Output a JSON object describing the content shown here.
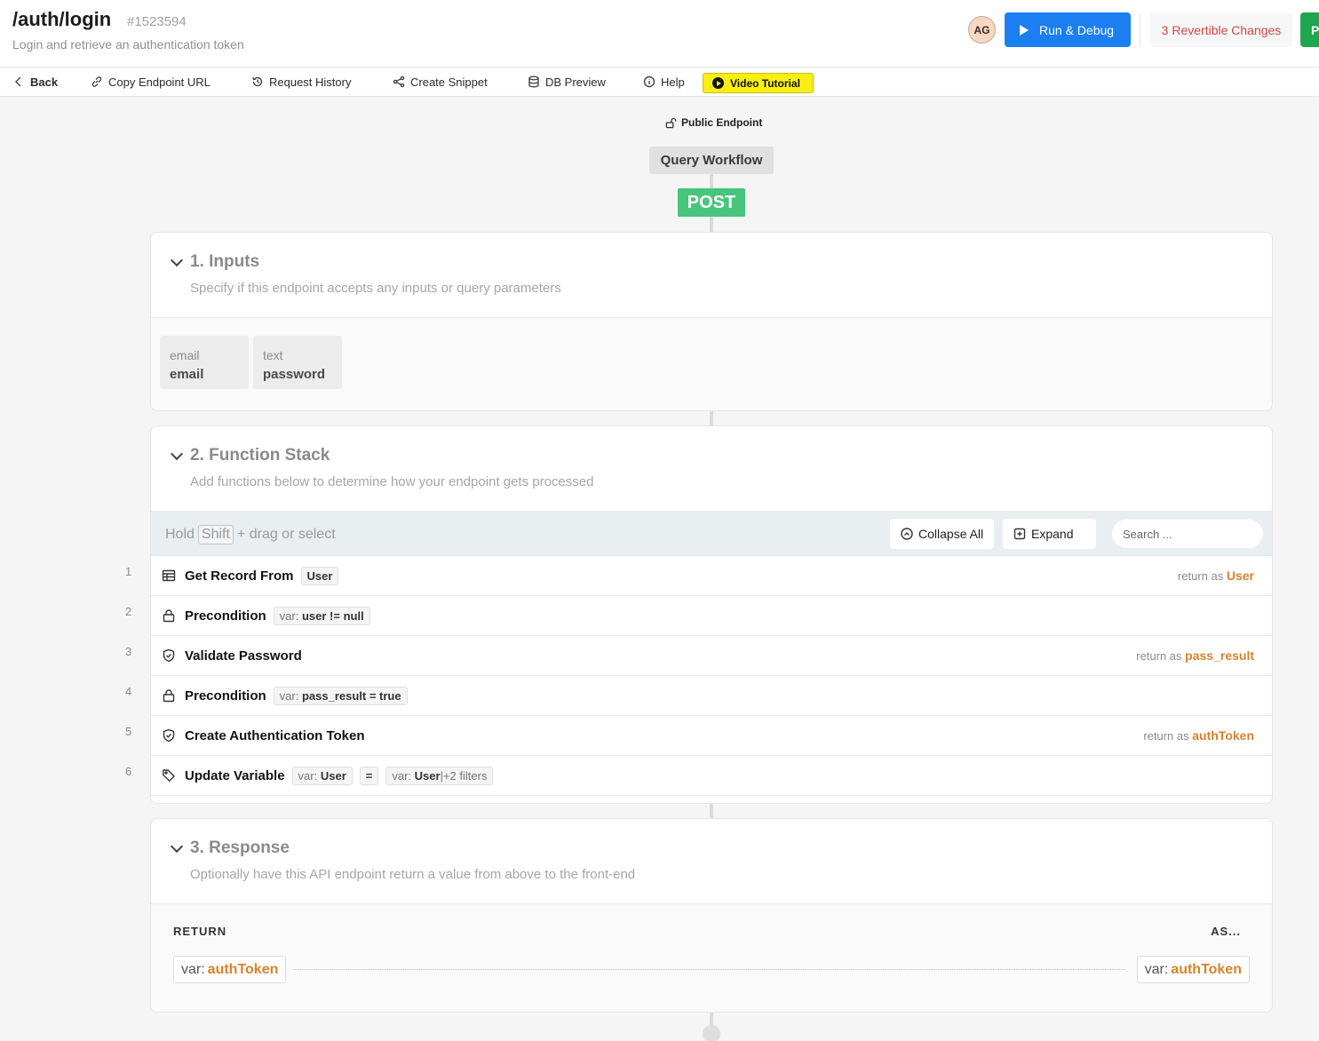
{
  "header": {
    "title": "/auth/login",
    "id": "#1523594",
    "subtitle": "Login and retrieve an authentication token",
    "avatar": "AG",
    "run_label": "Run & Debug",
    "changes_label": "3 Revertible Changes",
    "publish_label": "P"
  },
  "toolbar": {
    "back": "Back",
    "copy_url": "Copy Endpoint URL",
    "history": "Request History",
    "snippet": "Create Snippet",
    "db_preview": "DB Preview",
    "help": "Help",
    "video": "Video Tutorial"
  },
  "flow": {
    "public": "Public Endpoint",
    "query_workflow": "Query Workflow",
    "method": "POST"
  },
  "inputs": {
    "title": "1. Inputs",
    "desc": "Specify if this endpoint accepts any inputs or query parameters",
    "items": [
      {
        "type": "email",
        "name": "email"
      },
      {
        "type": "text",
        "name": "password"
      }
    ]
  },
  "stack": {
    "title": "2. Function Stack",
    "desc": "Add functions below to determine how your endpoint gets processed",
    "hold": "Hold",
    "shift": "Shift",
    "drag": "+ drag or select",
    "collapse_all": "Collapse All",
    "expand": "Expand",
    "search_placeholder": "Search ...",
    "return_as": "return as",
    "rows": [
      {
        "num": "1",
        "icon": "table-icon",
        "name": "Get Record From",
        "chip": "User",
        "ret": "User"
      },
      {
        "num": "2",
        "icon": "lock-icon",
        "name": "Precondition",
        "chip_prefix": "var:",
        "chip": "user != null"
      },
      {
        "num": "3",
        "icon": "shield-check-icon",
        "name": "Validate Password",
        "ret": "pass_result"
      },
      {
        "num": "4",
        "icon": "lock-icon",
        "name": "Precondition",
        "chip_prefix": "var:",
        "chip": "pass_result = true"
      },
      {
        "num": "5",
        "icon": "shield-check-icon",
        "name": "Create Authentication Token",
        "ret": "authToken"
      },
      {
        "num": "6",
        "icon": "tag-icon",
        "name": "Update Variable",
        "chip_prefix": "var:",
        "chip": "User",
        "op": "=",
        "chip2_prefix": "var:",
        "chip2": "User",
        "chip2_suffix": "|+2 filters"
      }
    ]
  },
  "response": {
    "title": "3. Response",
    "desc": "Optionally have this API endpoint return a value from above to the front-end",
    "return_label": "RETURN",
    "as_label": "AS...",
    "var_prefix": "var:",
    "value": "authToken",
    "as_value": "authToken"
  },
  "colors": {
    "accent_blue": "#1b7ff2",
    "post_green": "#48c57c",
    "return_orange": "#d9822b",
    "changes_red": "#d04646",
    "video_yellow": "#f7ee12"
  }
}
